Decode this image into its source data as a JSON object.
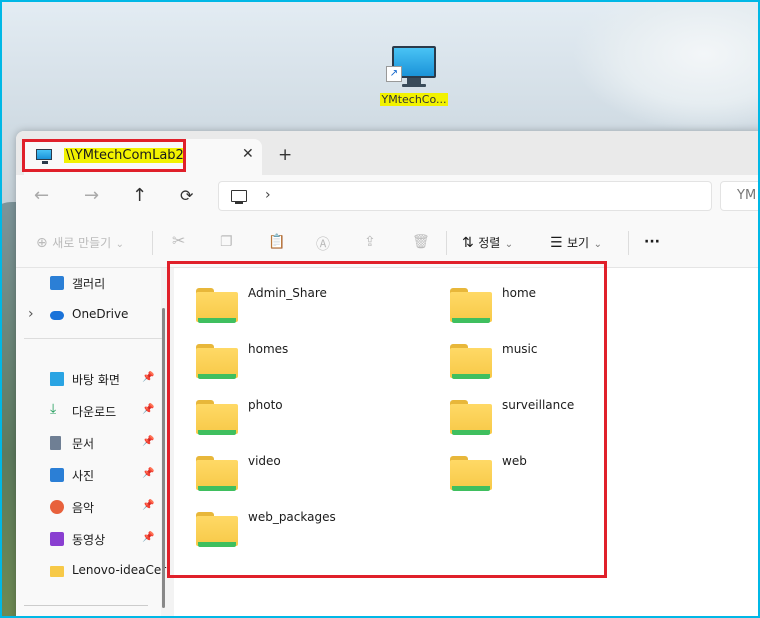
{
  "desktop": {
    "icon_label": "YMtechCo..."
  },
  "tab": {
    "title": "\\\\YMtechComLab2",
    "close_symbol": "✕",
    "new_tab_symbol": "+"
  },
  "nav": {
    "back": "←",
    "forward": "→",
    "up": "↑",
    "refresh": "⟳",
    "address_chevron": "›",
    "search_text": "YM"
  },
  "commands": {
    "new_label": "새로 만들기",
    "sort_label": "정렬",
    "view_label": "보기",
    "more": "···"
  },
  "sidebar": {
    "items": [
      {
        "label": "갤러리",
        "icon": "gallery-icon",
        "pinned": false
      },
      {
        "label": "OneDrive",
        "icon": "onedrive-icon",
        "pinned": false
      },
      {
        "label": "바탕 화면",
        "icon": "desktop-icon",
        "pinned": true
      },
      {
        "label": "다운로드",
        "icon": "download-icon",
        "pinned": true
      },
      {
        "label": "문서",
        "icon": "document-icon",
        "pinned": true
      },
      {
        "label": "사진",
        "icon": "pictures-icon",
        "pinned": true
      },
      {
        "label": "음악",
        "icon": "music-icon",
        "pinned": true
      },
      {
        "label": "동영상",
        "icon": "videos-icon",
        "pinned": true
      },
      {
        "label": "Lenovo-ideaCer",
        "icon": "folder-icon",
        "pinned": false
      }
    ],
    "expand_chevron": "›",
    "pin_symbol": "📌"
  },
  "folders": [
    "Admin_Share",
    "home",
    "homes",
    "music",
    "photo",
    "surveillance",
    "video",
    "web",
    "web_packages"
  ],
  "colors": {
    "highlight_border": "#e0202a",
    "frame_border": "#00b8e6",
    "name_highlight": "#f2f200"
  }
}
